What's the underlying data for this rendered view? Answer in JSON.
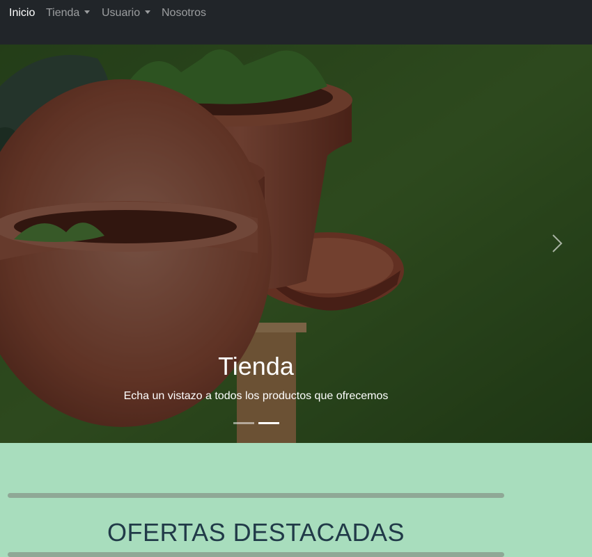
{
  "navbar": {
    "items": [
      {
        "label": "Inicio",
        "active": true
      },
      {
        "label": "Tienda",
        "dropdown": true
      },
      {
        "label": "Usuario",
        "dropdown": true
      },
      {
        "label": "Nosotros"
      }
    ]
  },
  "carousel": {
    "caption_title": "Tienda",
    "caption_text": "Echa un vistazo a todos los productos que ofrecemos",
    "slide_count": 2,
    "active_slide": 2,
    "next_icon": "chevron-right-icon"
  },
  "offers": {
    "title": "OFERTAS DESTACADAS"
  },
  "colors": {
    "navbar_bg": "#212529",
    "section_bg": "#a8ddbd",
    "title_color": "#213a48"
  }
}
